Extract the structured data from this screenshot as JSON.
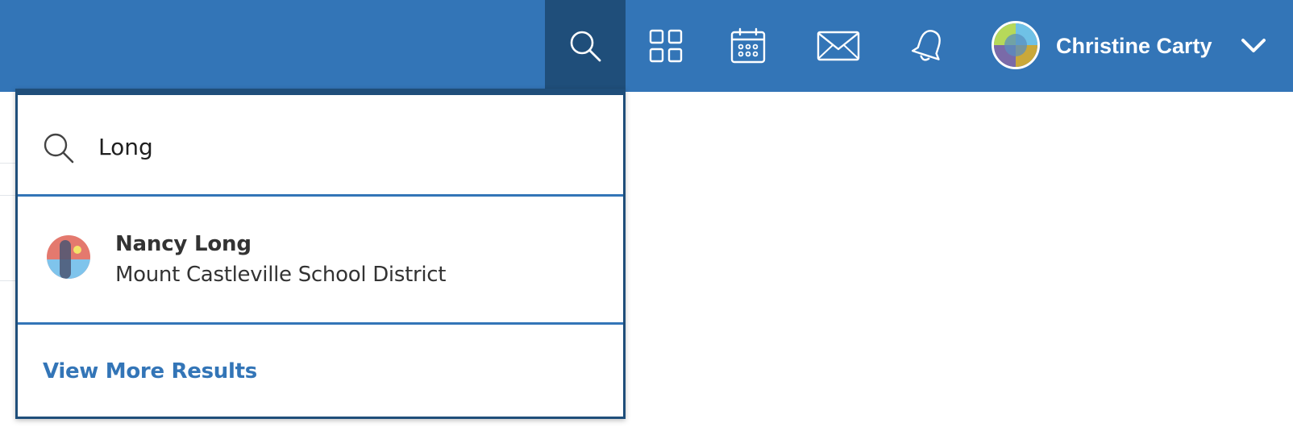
{
  "header": {
    "user_name": "Christine Carty",
    "accent_color": "#3375b7",
    "active_color": "#1f4e7a",
    "icons": [
      "search-icon",
      "apps-grid-icon",
      "calendar-icon",
      "mail-icon",
      "bell-icon",
      "chevron-down-icon"
    ]
  },
  "search": {
    "query": "Long",
    "results": [
      {
        "name": "Nancy Long",
        "organization": "Mount Castleville School District"
      }
    ],
    "view_more_label": "View More Results"
  }
}
